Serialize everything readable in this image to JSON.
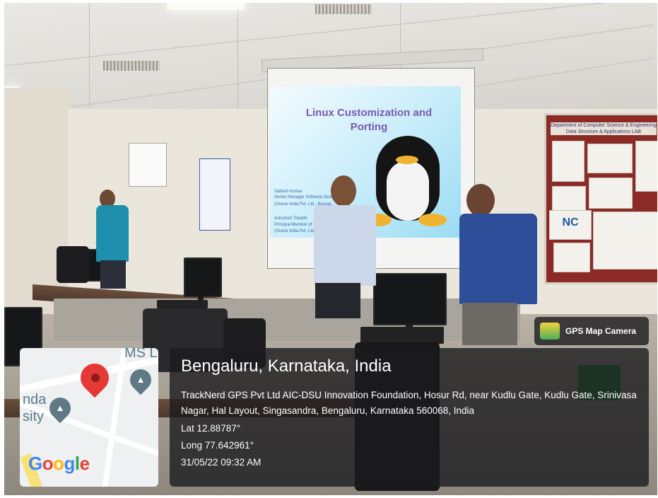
{
  "scene": {
    "slide_title": "Linux Customization and Porting",
    "slide_presenter_1_name": "Sabesh Kumar",
    "slide_presenter_1_role": "Senior Manager Software Develo...",
    "slide_presenter_1_org": "(Oracle India Pvt. Ltd., Bengal...",
    "slide_presenter_2_name": "Ashutosh Tripathi",
    "slide_presenter_2_role": "Principal Member of Technical",
    "slide_presenter_2_org": "(Oracle India Pvt. Ltd., Bengal...",
    "board_header_1": "Department of Computer Science & Engineering",
    "board_header_2": "Data Structure & Applications LAB",
    "board_stamp": "NC"
  },
  "overlay": {
    "badge_label": "GPS Map Camera",
    "map_label_1": "MS L",
    "map_label_2": "nda",
    "map_label_3": "sity",
    "map_brand": "Google",
    "location_title": "Bengaluru, Karnataka, India",
    "address": "TrackNerd GPS Pvt Ltd AIC-DSU Innovation Foundation, Hosur Rd, near Kudlu Gate, Kudlu Gate, Srinivasa Nagar, Hal Layout, Singasandra, Bengaluru, Karnataka 560068, India",
    "latitude": "Lat 12.88787°",
    "longitude": "Long 77.642961°",
    "datetime": "31/05/22 09:32 AM"
  },
  "colors": {
    "overlay_bg": "#1c1c1e",
    "pin": "#e53935",
    "google_blue": "#4285F4",
    "google_red": "#EA4335",
    "google_yellow": "#FBBC05",
    "google_green": "#34A853"
  },
  "icons": [
    "gps-map-camera-icon",
    "location-pin-icon",
    "education-pin-icon"
  ]
}
